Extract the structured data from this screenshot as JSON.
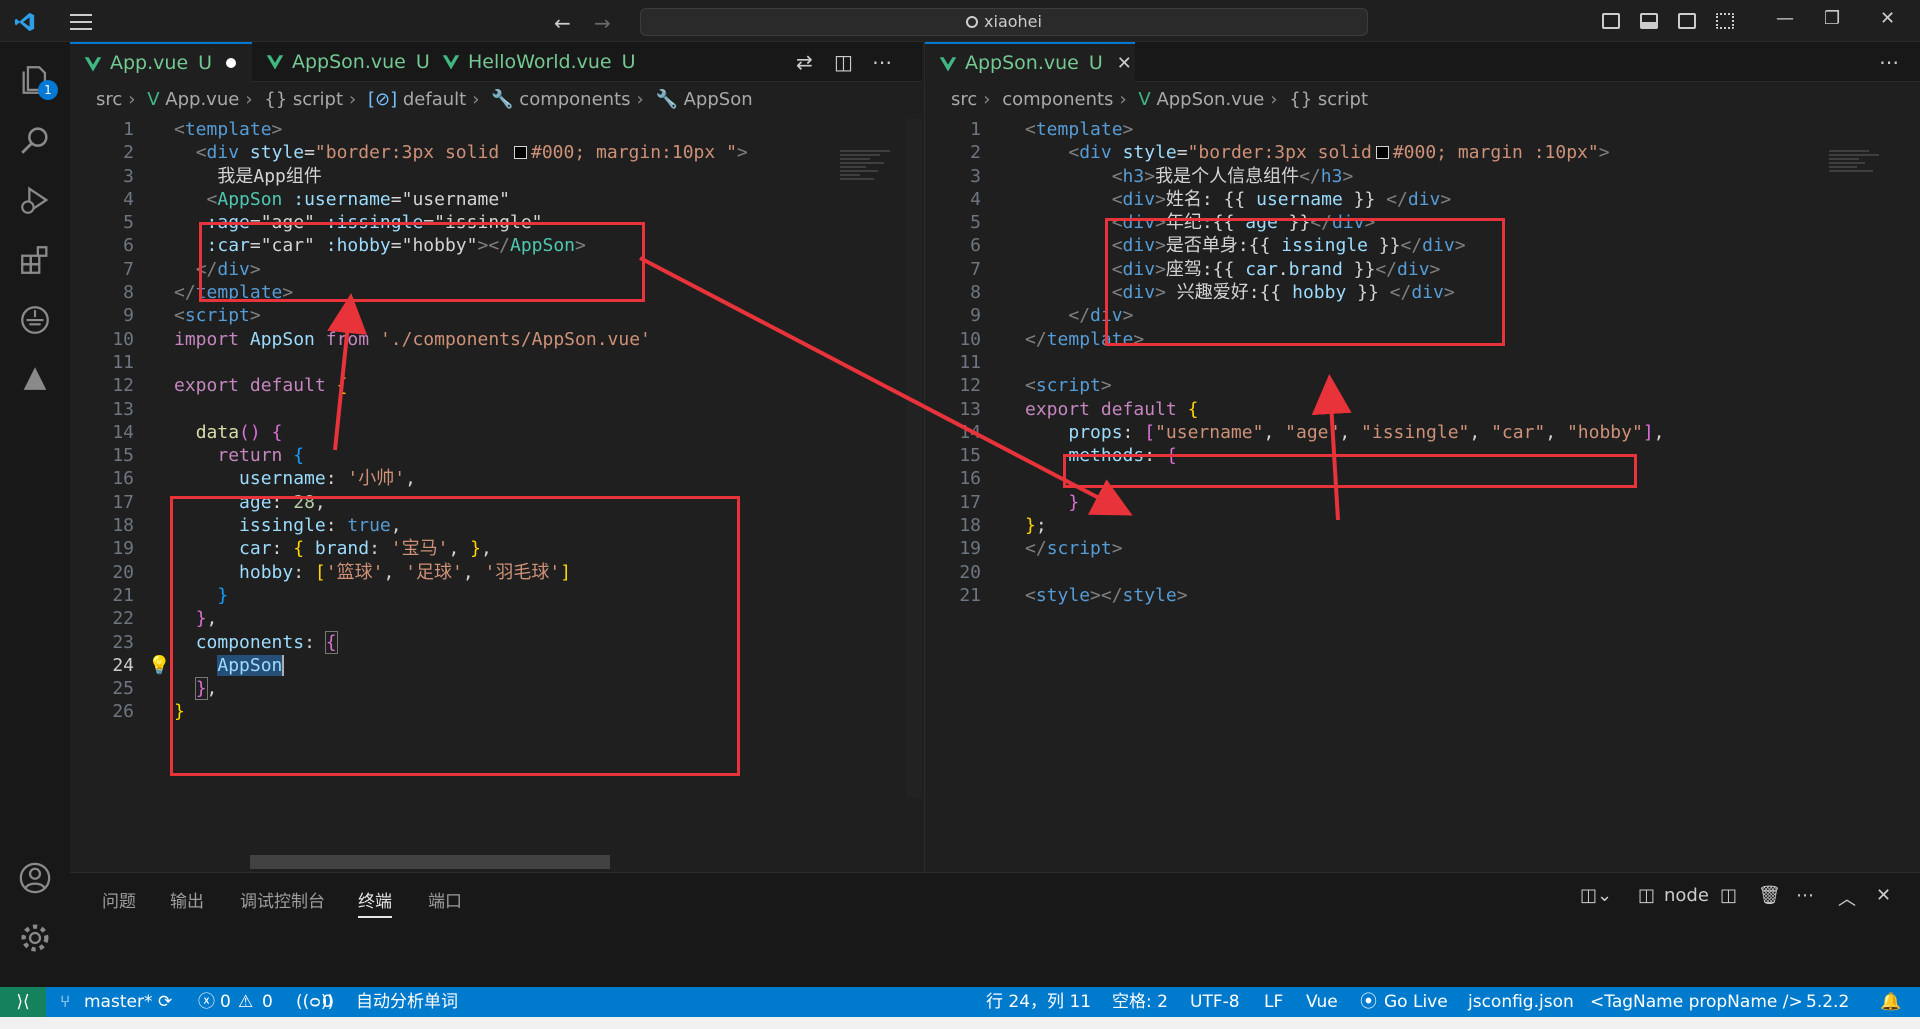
{
  "titlebar": {
    "search": "xiaohei"
  },
  "activity": {
    "explorer_badge": "1"
  },
  "left_editor": {
    "tabs": [
      {
        "label": "App.vue",
        "status": "U"
      },
      {
        "label": "AppSon.vue",
        "status": "U"
      },
      {
        "label": "HelloWorld.vue",
        "status": "U"
      }
    ],
    "breadcrumb": [
      "src",
      "App.vue",
      "{} script",
      "default",
      "components",
      "AppSon"
    ],
    "line_numbers": [
      "1",
      "2",
      "3",
      "4",
      "5",
      "6",
      "7",
      "8",
      "9",
      "10",
      "11",
      "12",
      "13",
      "14",
      "15",
      "16",
      "17",
      "18",
      "19",
      "20",
      "21",
      "22",
      "23",
      "24",
      "25",
      "26"
    ],
    "code": {
      "l3": "我是App组件",
      "s_username": "'小帅'",
      "n_age": "28",
      "s_brand": "'宝马'",
      "s_h1": "'篮球'",
      "s_h2": "'足球'",
      "s_h3": "'羽毛球'",
      "import_path": "'./components/AppSon.vue'"
    }
  },
  "right_editor": {
    "tab": {
      "label": "AppSon.vue",
      "status": "U"
    },
    "breadcrumb": [
      "src",
      "components",
      "AppSon.vue",
      "{} script"
    ],
    "line_numbers": [
      "1",
      "2",
      "3",
      "4",
      "5",
      "6",
      "7",
      "8",
      "9",
      "10",
      "11",
      "12",
      "13",
      "14",
      "15",
      "16",
      "17",
      "18",
      "19",
      "20",
      "21"
    ],
    "code": {
      "h3": "我是个人信息组件",
      "name": "姓名: ",
      "age": "年纪:",
      "single": "是否单身:",
      "car": "座驾:",
      "hobby": " 兴趣爱好:"
    }
  },
  "panel": {
    "tabs": [
      "问题",
      "输出",
      "调试控制台",
      "终端",
      "端口"
    ],
    "active_tab": "终端",
    "terminal_name": "node"
  },
  "statusbar": {
    "branch": "master*",
    "errors": "0",
    "warnings": "0",
    "ports": "0",
    "auto_analyze": "自动分析单词",
    "cursor": "行 24，列 11",
    "indent": "空格: 2",
    "encoding": "UTF-8",
    "eol": "LF",
    "language": "Vue",
    "golive": "Go Live",
    "config": "jsconfig.json",
    "tagname": "<TagName propName />",
    "version": "5.2.2"
  },
  "colors": {
    "accent": "#007acc",
    "annotation": "#e8333a",
    "vue_green": "#73c991"
  }
}
